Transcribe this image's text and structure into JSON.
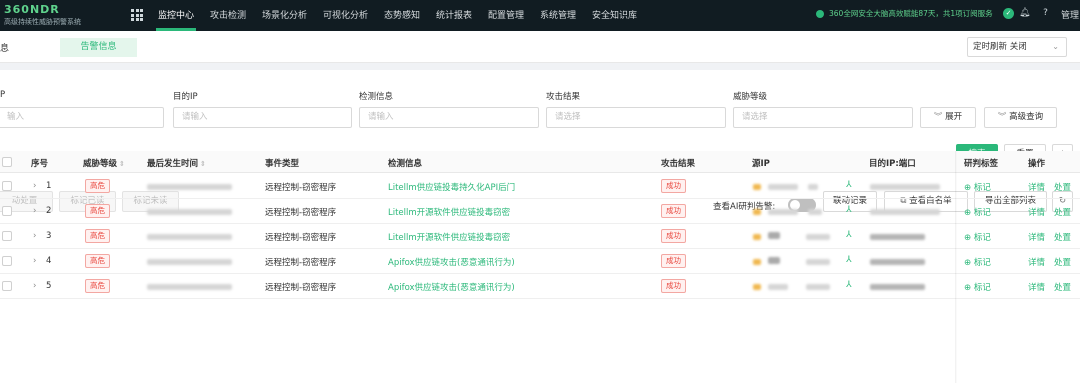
{
  "app": {
    "brand": "360NDR",
    "subtitle": "高级持续性威胁预警系统"
  },
  "nav": {
    "items": [
      "监控中心",
      "攻击检测",
      "场景化分析",
      "可视化分析",
      "态势感知",
      "统计报表",
      "配置管理",
      "系统管理",
      "安全知识库"
    ],
    "notice": "360全网安全大脑高效赋能87天，共1项订阅服务",
    "user": "管理"
  },
  "tabs": {
    "previous_fragment": "息",
    "active": "告警信息"
  },
  "refresh": {
    "value": "定时刷新 关闭"
  },
  "filters": {
    "labels": [
      "P",
      "目的IP",
      "检测信息",
      "攻击结果",
      "威胁等级"
    ],
    "placeholders": [
      "输入",
      "请输入",
      "请输入",
      "请选择",
      "请选择"
    ],
    "expand_label": "展开",
    "advanced_label": "高级查询",
    "search_label": "搜索",
    "reset_label": "重置"
  },
  "toolbar": {
    "bulk_label": "动处置",
    "mark_read_label": "标记已读",
    "mark_unread_label": "标记未读",
    "ai_toggle_label": "查看AI研判告警:",
    "linkage_label": "联动记录",
    "whitelist_label": "查看白名单",
    "export_label": "导出全部列表"
  },
  "table": {
    "columns": [
      "序号",
      "威胁等级",
      "最后发生时间",
      "事件类型",
      "检测信息",
      "攻击结果",
      "源IP",
      "目的IP:端口",
      "研判标签",
      "操作"
    ],
    "rows": [
      {
        "index": "1",
        "level": "高危",
        "event_type": "远程控制-窃密程序",
        "detection": "Litellm供应链投毒持久化API后门",
        "result": "成功"
      },
      {
        "index": "2",
        "level": "高危",
        "event_type": "远程控制-窃密程序",
        "detection": "Litellm开源软件供应链投毒窃密",
        "result": "成功"
      },
      {
        "index": "3",
        "level": "高危",
        "event_type": "远程控制-窃密程序",
        "detection": "Litellm开源软件供应链投毒窃密",
        "result": "成功"
      },
      {
        "index": "4",
        "level": "高危",
        "event_type": "远程控制-窃密程序",
        "detection": "Apifox供应链攻击(恶意通讯行为)",
        "result": "成功"
      },
      {
        "index": "5",
        "level": "高危",
        "event_type": "远程控制-窃密程序",
        "detection": "Apifox供应链攻击(恶意通讯行为)",
        "result": "成功"
      }
    ],
    "tag_action": "标记",
    "detail_action": "详情",
    "dispose_action": "处置"
  },
  "colors": {
    "accent": "#2bb87a",
    "danger": "#e8453c",
    "topbar": "#111c22"
  },
  "icons": [
    "apps-grid-icon",
    "bell-icon",
    "help-icon",
    "star-icon",
    "refresh-icon",
    "external-link-icon",
    "network-icon",
    "plus-circle-icon",
    "chevron-right-icon",
    "double-chevron-down-icon"
  ]
}
